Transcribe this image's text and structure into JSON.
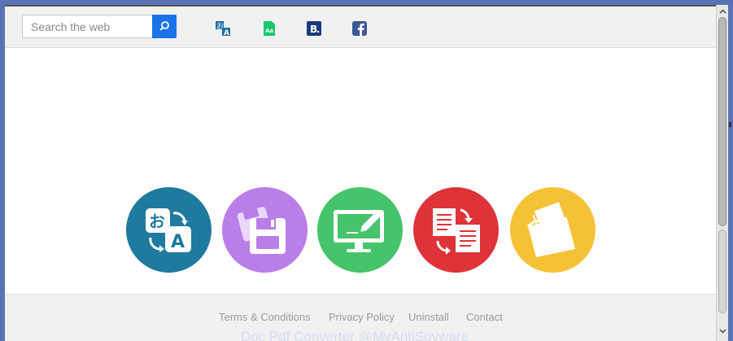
{
  "search": {
    "placeholder": "Search the web"
  },
  "toolbar": {
    "icons": [
      "translate-icon",
      "dictionary-icon",
      "bookmark-b-icon",
      "facebook-icon"
    ]
  },
  "features": [
    {
      "name": "translate",
      "color": "#1e7a9e"
    },
    {
      "name": "save-files",
      "color": "#b97ee8"
    },
    {
      "name": "edit-screen",
      "color": "#45c46b"
    },
    {
      "name": "convert-documents",
      "color": "#dd3339"
    },
    {
      "name": "folder",
      "color": "#f6c235"
    }
  ],
  "footer": {
    "links": [
      "Terms & Conditions",
      "Privacy Policy",
      "Uninstall",
      "Contact"
    ],
    "watermark": "Doc Pdf Converter @MyAntiSpyware"
  },
  "colors": {
    "accent": "#1a73e8",
    "background": "#5a72b6"
  }
}
